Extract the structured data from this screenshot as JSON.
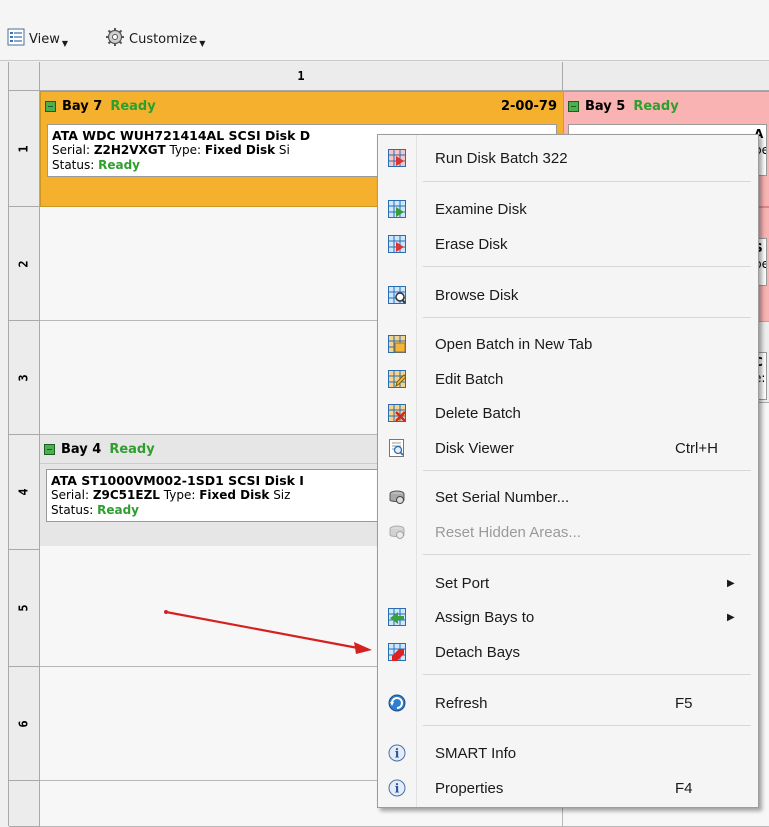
{
  "toolbar": {
    "view_label": "View",
    "customize_label": "Customize"
  },
  "grid": {
    "column_header": "1",
    "rows": [
      "1",
      "2",
      "3",
      "4",
      "5",
      "6"
    ]
  },
  "bays": {
    "bay7": {
      "name": "Bay 7",
      "status": "Ready",
      "code": "2-00-79",
      "model": "ATA WDC WUH721414AL SCSI Disk D",
      "serial_label": "Serial:",
      "serial": "Z2H2VXGT",
      "type_label": "Type:",
      "type": "Fixed Disk",
      "size_label": "Si",
      "status_label": "Status:",
      "status_value": "Ready",
      "color": "#f5b02e"
    },
    "bay5": {
      "name": "Bay 5",
      "status": "Ready",
      "color": "#f9b3b3"
    },
    "bay4": {
      "name": "Bay 4",
      "status": "Ready",
      "model": "ATA ST1000VM002-1SD1 SCSI Disk I",
      "serial_label": "Serial:",
      "serial": "Z9C51EZL",
      "type_label": "Type:",
      "type": "Fixed Disk",
      "size_label": "Siz",
      "status_label": "Status:",
      "status_value": "Ready"
    },
    "right_fragments": {
      "row1_a": "A",
      "row1_b": "pe",
      "row2_a": "S",
      "row2_b": "pe",
      "row3_a": "C",
      "row3_b": "e:"
    }
  },
  "context_menu": {
    "items": [
      {
        "label": "Run Disk Batch 322",
        "icon": "run-batch-icon"
      },
      {
        "label": "Examine Disk",
        "icon": "examine-disk-icon"
      },
      {
        "label": "Erase Disk",
        "icon": "erase-disk-icon"
      },
      {
        "label": "Browse Disk",
        "icon": "browse-disk-icon"
      },
      {
        "label": "Open Batch in New Tab",
        "icon": "open-batch-icon"
      },
      {
        "label": "Edit Batch",
        "icon": "edit-batch-icon"
      },
      {
        "label": "Delete Batch",
        "icon": "delete-batch-icon"
      },
      {
        "label": "Disk Viewer",
        "icon": "disk-viewer-icon",
        "shortcut": "Ctrl+H"
      },
      {
        "label": "Set Serial Number...",
        "icon": "serial-number-icon"
      },
      {
        "label": "Reset Hidden Areas...",
        "icon": "reset-hidden-icon",
        "disabled": true
      },
      {
        "label": "Set Port",
        "submenu": true
      },
      {
        "label": "Assign Bays to",
        "icon": "assign-bays-icon",
        "submenu": true
      },
      {
        "label": "Detach Bays",
        "icon": "detach-bays-icon"
      },
      {
        "label": "Refresh",
        "icon": "refresh-icon",
        "shortcut": "F5"
      },
      {
        "label": "SMART Info",
        "icon": "info-icon"
      },
      {
        "label": "Properties",
        "icon": "info-icon",
        "shortcut": "F4"
      }
    ]
  },
  "annotation": {
    "arrow_color": "#d62020"
  }
}
